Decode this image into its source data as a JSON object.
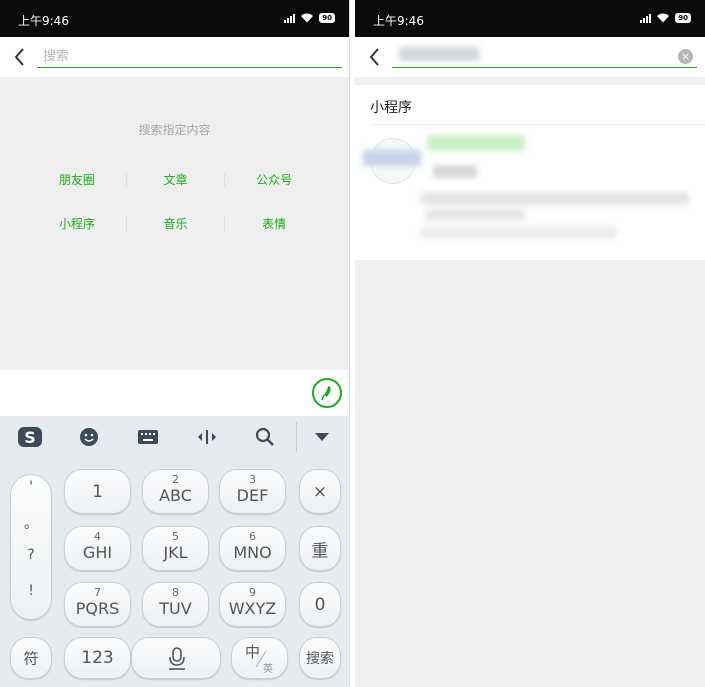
{
  "status": {
    "time": "上午9:46",
    "battery": "90"
  },
  "left": {
    "search": {
      "placeholder": "搜索"
    },
    "hint": "搜索指定内容",
    "categories": [
      [
        "朋友圈",
        "文章",
        "公众号"
      ],
      [
        "小程序",
        "音乐",
        "表情"
      ]
    ]
  },
  "keyboard": {
    "punctuation": [
      "'",
      "。",
      "?",
      "!"
    ],
    "rows": [
      [
        {
          "num": "",
          "label": "1"
        },
        {
          "num": "2",
          "label": "ABC"
        },
        {
          "num": "3",
          "label": "DEF"
        }
      ],
      [
        {
          "num": "4",
          "label": "GHI"
        },
        {
          "num": "5",
          "label": "JKL"
        },
        {
          "num": "6",
          "label": "MNO"
        }
      ],
      [
        {
          "num": "7",
          "label": "PQRS"
        },
        {
          "num": "8",
          "label": "TUV"
        },
        {
          "num": "9",
          "label": "WXYZ"
        }
      ]
    ],
    "side": {
      "delete": "×",
      "reenter": "重",
      "zero": "0",
      "search": "搜索"
    },
    "bottom": {
      "symbols": "符",
      "numbers": "123",
      "lang_main": "中",
      "lang_alt": "英"
    }
  },
  "right": {
    "section_title": "小程序"
  },
  "colors": {
    "accent": "#1aad19",
    "statusbar": "#0a0a0a",
    "background": "#efefef",
    "keyboard": "#e7ebf0"
  }
}
